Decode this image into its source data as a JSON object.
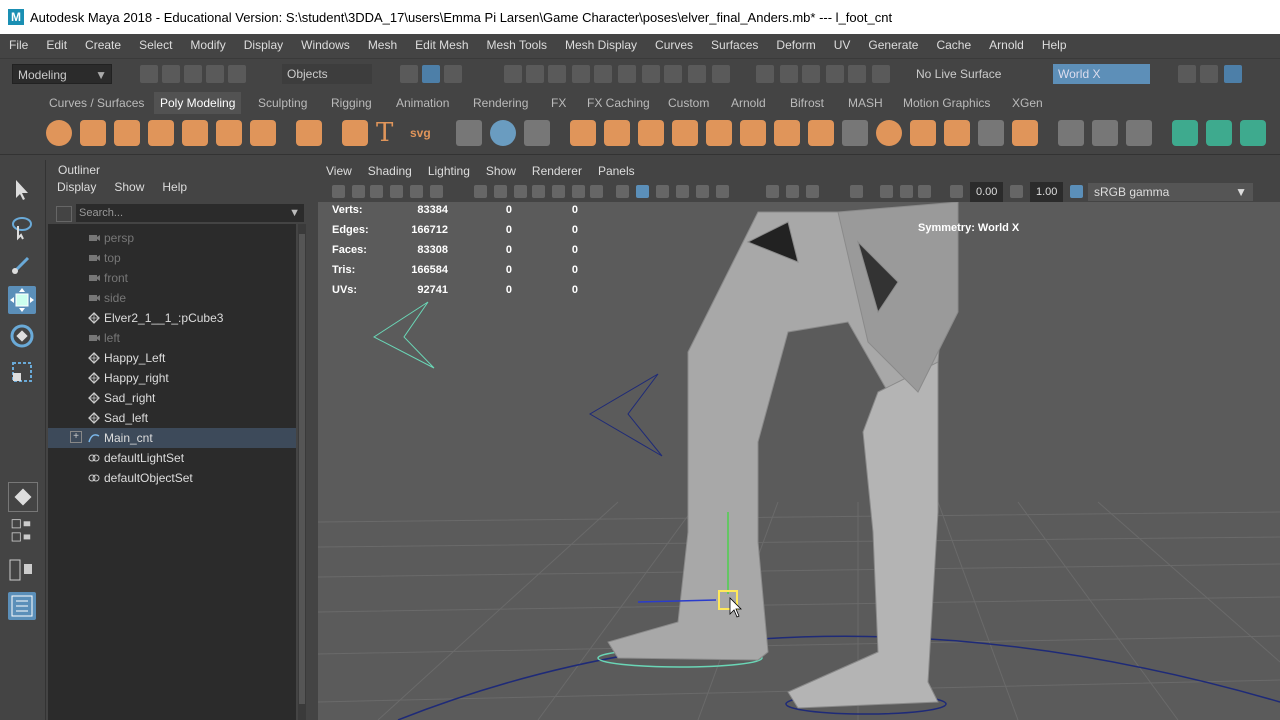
{
  "title": {
    "text": "Autodesk Maya 2018 - Educational Version: S:\\student\\3DDA_17\\users\\Emma Pi Larsen\\Game Character\\poses\\elver_final_Anders.mb*   ---   l_foot_cnt",
    "logo": "M"
  },
  "menu": [
    "File",
    "Edit",
    "Create",
    "Select",
    "Modify",
    "Display",
    "Windows",
    "Mesh",
    "Edit Mesh",
    "Mesh Tools",
    "Mesh Display",
    "Curves",
    "Surfaces",
    "Deform",
    "UV",
    "Generate",
    "Cache",
    "Arnold",
    "Help"
  ],
  "status_line": {
    "mode": "Modeling",
    "objects": "Objects",
    "live_surface": "No Live Surface",
    "symmetry": "World X"
  },
  "shelf_tabs": [
    "Curves / Surfaces",
    "Poly Modeling",
    "Sculpting",
    "Rigging",
    "Animation",
    "Rendering",
    "FX",
    "FX Caching",
    "Custom",
    "Arnold",
    "Bifrost",
    "MASH",
    "Motion Graphics",
    "XGen"
  ],
  "shelf_active": "Poly Modeling",
  "shelf_text_icons": {
    "text": "T",
    "svg": "svg"
  },
  "outliner": {
    "title": "Outliner",
    "menu": [
      "Display",
      "Show",
      "Help"
    ],
    "search_placeholder": "Search...",
    "items": [
      {
        "label": "persp",
        "dim": true,
        "icon": "camera-icon"
      },
      {
        "label": "top",
        "dim": true,
        "icon": "camera-icon"
      },
      {
        "label": "front",
        "dim": true,
        "icon": "camera-icon"
      },
      {
        "label": "side",
        "dim": true,
        "icon": "camera-icon"
      },
      {
        "label": "Elver2_1__1_:pCube3",
        "dim": false,
        "icon": "mesh-icon"
      },
      {
        "label": "left",
        "dim": true,
        "icon": "camera-icon"
      },
      {
        "label": "Happy_Left",
        "dim": false,
        "icon": "mesh-icon"
      },
      {
        "label": "Happy_right",
        "dim": false,
        "icon": "mesh-icon"
      },
      {
        "label": "Sad_right",
        "dim": false,
        "icon": "mesh-icon"
      },
      {
        "label": "Sad_left",
        "dim": false,
        "icon": "mesh-icon"
      },
      {
        "label": "Main_cnt",
        "dim": false,
        "icon": "curve-icon",
        "selected": true,
        "expand": "+"
      },
      {
        "label": "defaultLightSet",
        "dim": false,
        "icon": "set-icon"
      },
      {
        "label": "defaultObjectSet",
        "dim": false,
        "icon": "set-icon"
      }
    ]
  },
  "viewport": {
    "menu": [
      "View",
      "Shading",
      "Lighting",
      "Show",
      "Renderer",
      "Panels"
    ],
    "exposure": "0.00",
    "gamma_value": "1.00",
    "color_space": "sRGB gamma",
    "symmetry_label": "Symmetry: World X",
    "hud": [
      {
        "label": "Verts:",
        "v1": "83384",
        "v2": "0",
        "v3": "0"
      },
      {
        "label": "Edges:",
        "v1": "166712",
        "v2": "0",
        "v3": "0"
      },
      {
        "label": "Faces:",
        "v1": "83308",
        "v2": "0",
        "v3": "0"
      },
      {
        "label": "Tris:",
        "v1": "166584",
        "v2": "0",
        "v3": "0"
      },
      {
        "label": "UVs:",
        "v1": "92741",
        "v2": "0",
        "v3": "0"
      }
    ]
  },
  "colors": {
    "selection": "#5b8fb9",
    "shelf_orange": "#e0955a",
    "shelf_green": "#3eaa8e",
    "worldx_field": "#5d8fb8"
  }
}
